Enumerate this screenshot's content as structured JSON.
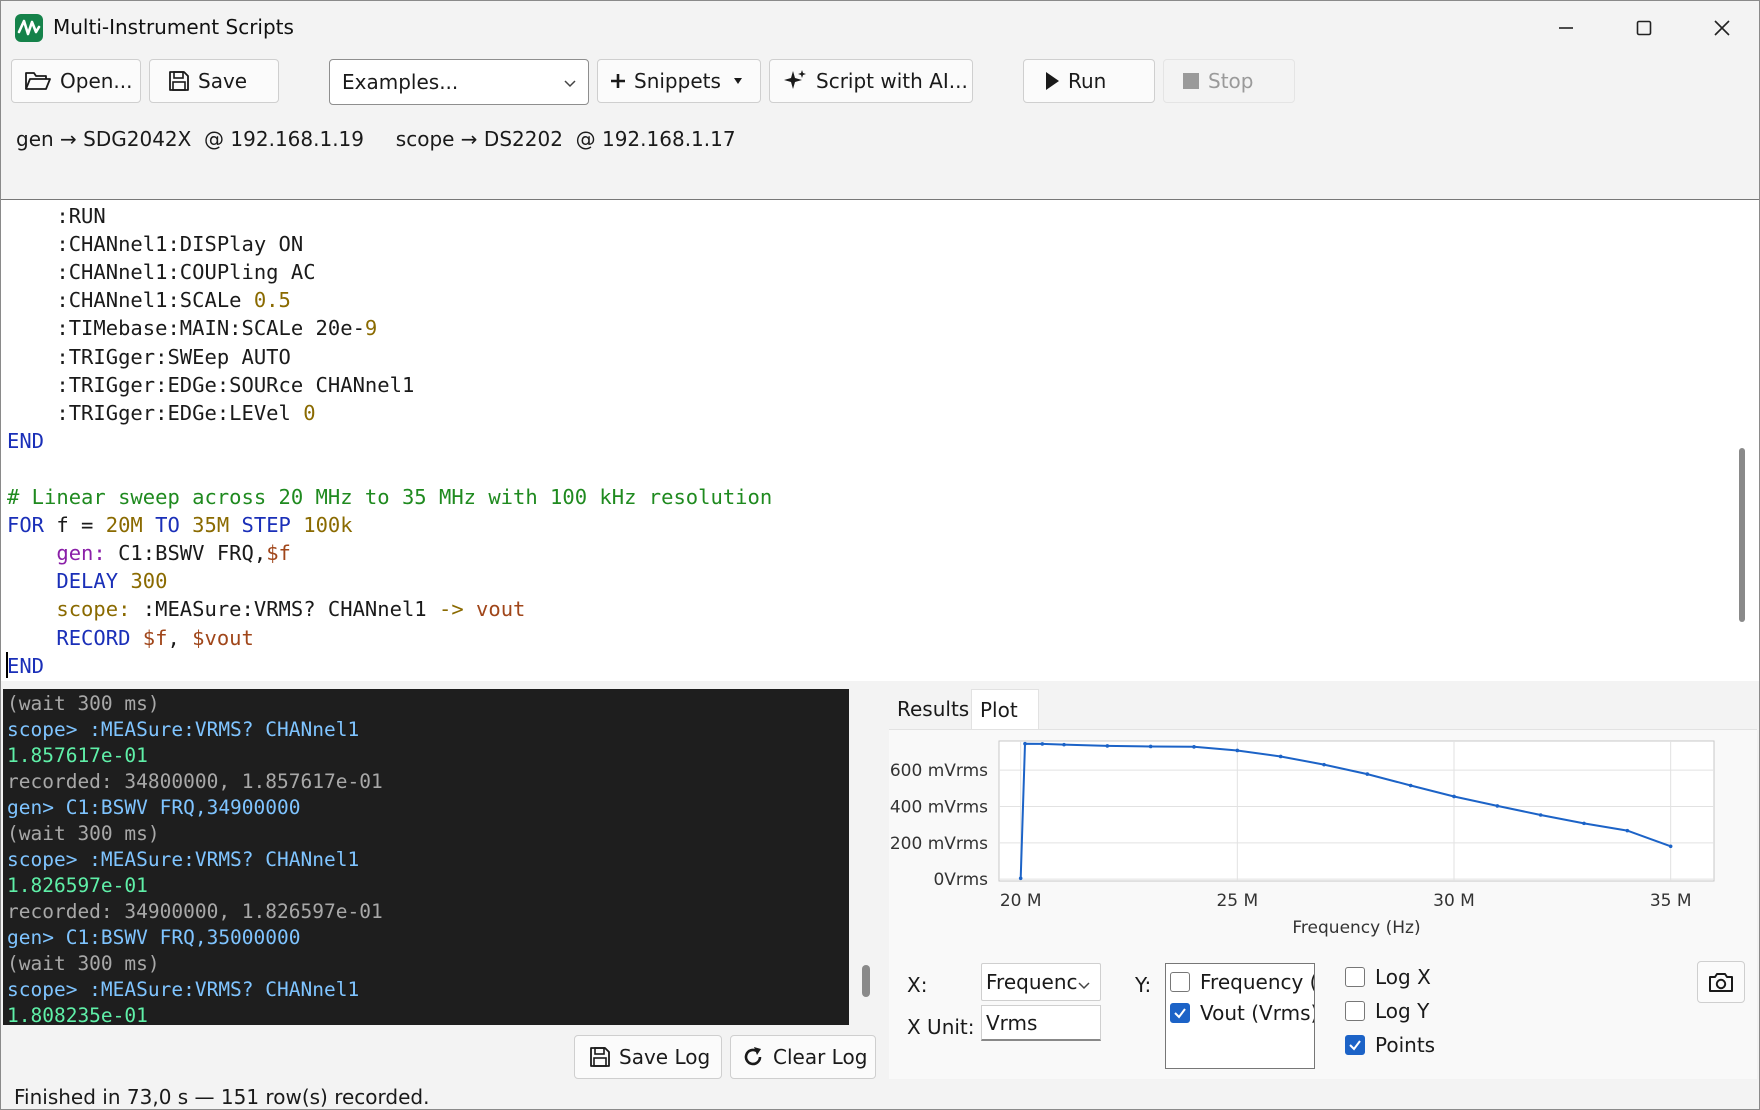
{
  "window": {
    "title": "Multi-Instrument Scripts",
    "accent": "#15824a"
  },
  "toolbar": {
    "open_label": "Open...",
    "save_label": "Save",
    "examples_label": "Examples...",
    "snippets_label": "Snippets",
    "ai_label": "Script with AI...",
    "run_label": "Run",
    "stop_label": "Stop"
  },
  "devices": "gen → SDG2042X  @ 192.168.1.19     scope → DS2202  @ 192.168.1.17",
  "editor": {
    "lines": [
      [
        [
          "    :RUN",
          "t"
        ]
      ],
      [
        [
          "    :CHANnel1:DISPlay ON",
          "t"
        ]
      ],
      [
        [
          "    :CHANnel1:COUPling AC",
          "t"
        ]
      ],
      [
        [
          "    :CHANnel1:SCALe ",
          "t"
        ],
        [
          "0.5",
          "num"
        ]
      ],
      [
        [
          "    :TIMebase:MAIN:SCALe 20e-",
          "t"
        ],
        [
          "9",
          "num"
        ]
      ],
      [
        [
          "    :TRIGger:SWEep AUTO",
          "t"
        ]
      ],
      [
        [
          "    :TRIGger:EDGe:SOURce CHANnel1",
          "t"
        ]
      ],
      [
        [
          "    :TRIGger:EDGe:LEVel ",
          "t"
        ],
        [
          "0",
          "num"
        ]
      ],
      [
        [
          "END",
          "kw"
        ]
      ],
      [
        [
          "",
          "t"
        ]
      ],
      [
        [
          "# Linear sweep across 20 MHz to 35 MHz with 100 kHz resolution",
          "cmt"
        ]
      ],
      [
        [
          "FOR",
          "kw"
        ],
        [
          " f = ",
          "t"
        ],
        [
          "20M",
          "num"
        ],
        [
          " ",
          "t"
        ],
        [
          "TO",
          "kw"
        ],
        [
          " ",
          "t"
        ],
        [
          "35M",
          "num"
        ],
        [
          " ",
          "t"
        ],
        [
          "STEP",
          "kw"
        ],
        [
          " ",
          "t"
        ],
        [
          "100k",
          "num"
        ]
      ],
      [
        [
          "    ",
          "t"
        ],
        [
          "gen:",
          "dev"
        ],
        [
          " C1:BSWV FRQ,",
          "t"
        ],
        [
          "$f",
          "var"
        ]
      ],
      [
        [
          "    ",
          "t"
        ],
        [
          "DELAY",
          "kw"
        ],
        [
          " ",
          "t"
        ],
        [
          "300",
          "num"
        ]
      ],
      [
        [
          "    ",
          "t"
        ],
        [
          "scope:",
          "num"
        ],
        [
          " :MEASure:VRMS? CHANnel1 ",
          "t"
        ],
        [
          "->",
          "num"
        ],
        [
          " ",
          "t"
        ],
        [
          "vout",
          "var"
        ]
      ],
      [
        [
          "    ",
          "t"
        ],
        [
          "RECORD",
          "kw"
        ],
        [
          " ",
          "t"
        ],
        [
          "$f",
          "var"
        ],
        [
          ", ",
          "t"
        ],
        [
          "$vout",
          "var"
        ]
      ],
      [
        [
          "END",
          "kw"
        ]
      ]
    ]
  },
  "log": {
    "lines": [
      [
        "(wait 300 ms)",
        "gray"
      ],
      [
        "scope> :MEASure:VRMS? CHANnel1",
        "blue"
      ],
      [
        "1.857617e-01",
        "green"
      ],
      [
        "recorded: 34800000, 1.857617e-01",
        "gray"
      ],
      [
        "gen> C1:BSWV FRQ,34900000",
        "blue"
      ],
      [
        "(wait 300 ms)",
        "gray"
      ],
      [
        "scope> :MEASure:VRMS? CHANnel1",
        "blue"
      ],
      [
        "1.826597e-01",
        "green"
      ],
      [
        "recorded: 34900000, 1.826597e-01",
        "gray"
      ],
      [
        "gen> C1:BSWV FRQ,35000000",
        "blue"
      ],
      [
        "(wait 300 ms)",
        "gray"
      ],
      [
        "scope> :MEASure:VRMS? CHANnel1",
        "blue"
      ],
      [
        "1.808235e-01",
        "green"
      ]
    ],
    "save_log_label": "Save Log",
    "clear_log_label": "Clear Log"
  },
  "status": "Finished in 73,0 s — 151 row(s) recorded.",
  "tabs": {
    "results": "Results",
    "plot": "Plot"
  },
  "plot_controls": {
    "x_label": "X:",
    "x_value": "Frequenc",
    "x_unit_label": "X Unit:",
    "x_unit_value": "Vrms",
    "y_label": "Y:",
    "y_items": [
      {
        "label": "Frequency (H",
        "checked": false
      },
      {
        "label": "Vout (Vrms)",
        "checked": true
      }
    ],
    "log_x": "Log X",
    "log_y": "Log Y",
    "points": "Points",
    "log_x_checked": false,
    "log_y_checked": false,
    "points_checked": true
  },
  "chart_data": {
    "type": "line",
    "xlabel": "Frequency (Hz)",
    "ylabel": "",
    "x_ticks": [
      "20 M",
      "25 M",
      "30 M",
      "35 M"
    ],
    "y_ticks": [
      "0Vrms",
      "200 mVrms",
      "400 mVrms",
      "600 mVrms"
    ],
    "xlim": [
      19500000,
      36000000
    ],
    "ylim": [
      -10,
      760
    ],
    "grid": true,
    "line_color": "#1c63c7",
    "series": [
      {
        "x": [
          20000000,
          20100000,
          20500000,
          21000000,
          22000000,
          23000000,
          24000000,
          25000000,
          26000000,
          27000000,
          28000000,
          29000000,
          30000000,
          31000000,
          32000000,
          33000000,
          34000000,
          35000000
        ],
        "values": [
          5,
          745,
          744,
          740,
          733,
          730,
          728,
          708,
          675,
          630,
          578,
          515,
          455,
          403,
          353,
          307,
          267,
          181
        ]
      }
    ]
  }
}
